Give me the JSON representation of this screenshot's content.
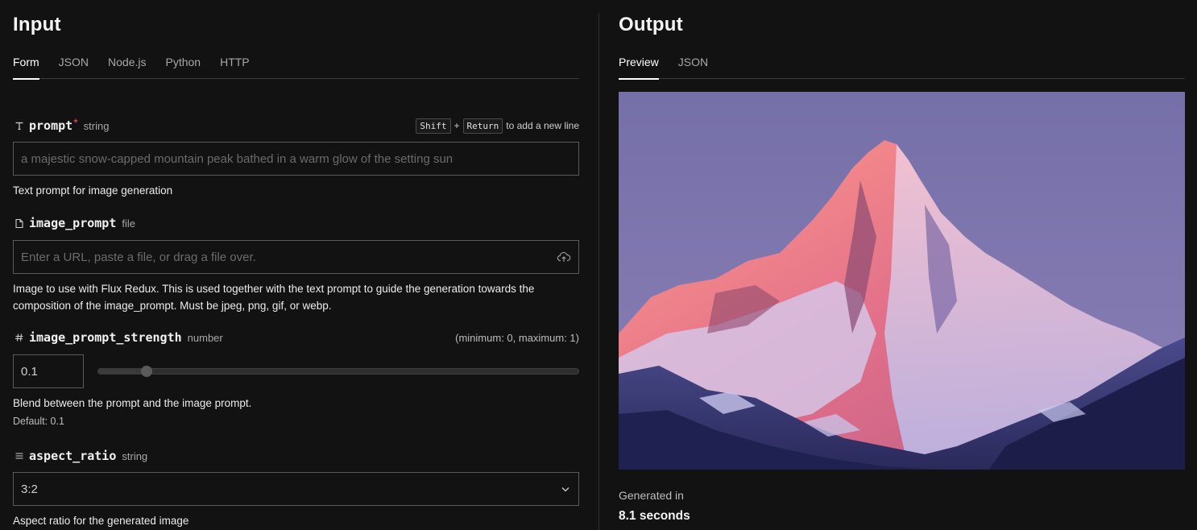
{
  "input": {
    "title": "Input",
    "tabs": [
      "Form",
      "JSON",
      "Node.js",
      "Python",
      "HTTP"
    ],
    "active_tab": "Form",
    "fields": {
      "prompt": {
        "name": "prompt",
        "required_mark": "*",
        "type": "string",
        "hint_key1": "Shift",
        "hint_plus": "+",
        "hint_key2": "Return",
        "hint_text": "to add a new line",
        "placeholder": "a majestic snow-capped mountain peak bathed in a warm glow of the setting sun",
        "description": "Text prompt for image generation"
      },
      "image_prompt": {
        "name": "image_prompt",
        "type": "file",
        "placeholder": "Enter a URL, paste a file, or drag a file over.",
        "description": "Image to use with Flux Redux. This is used together with the text prompt to guide the generation towards the composition of the image_prompt. Must be jpeg, png, gif, or webp."
      },
      "image_prompt_strength": {
        "name": "image_prompt_strength",
        "type": "number",
        "range_note": "(minimum: 0, maximum: 1)",
        "value": "0.1",
        "slider_fraction": 0.1,
        "description": "Blend between the prompt and the image prompt.",
        "default_text": "Default: 0.1"
      },
      "aspect_ratio": {
        "name": "aspect_ratio",
        "type": "string",
        "selected": "3:2",
        "description": "Aspect ratio for the generated image"
      }
    }
  },
  "output": {
    "title": "Output",
    "tabs": [
      "Preview",
      "JSON"
    ],
    "active_tab": "Preview",
    "generated_label": "Generated in",
    "generated_value": "8.1 seconds"
  },
  "icons": {
    "prompt": "text-type-icon",
    "image_prompt": "file-icon",
    "image_prompt_strength": "hash-icon",
    "aspect_ratio": "list-icon",
    "upload": "cloud-upload-icon",
    "dropdown": "chevron-down-icon"
  },
  "colors": {
    "background": "#121212",
    "required": "#ff4b4b",
    "sky": "#7e76ad"
  }
}
